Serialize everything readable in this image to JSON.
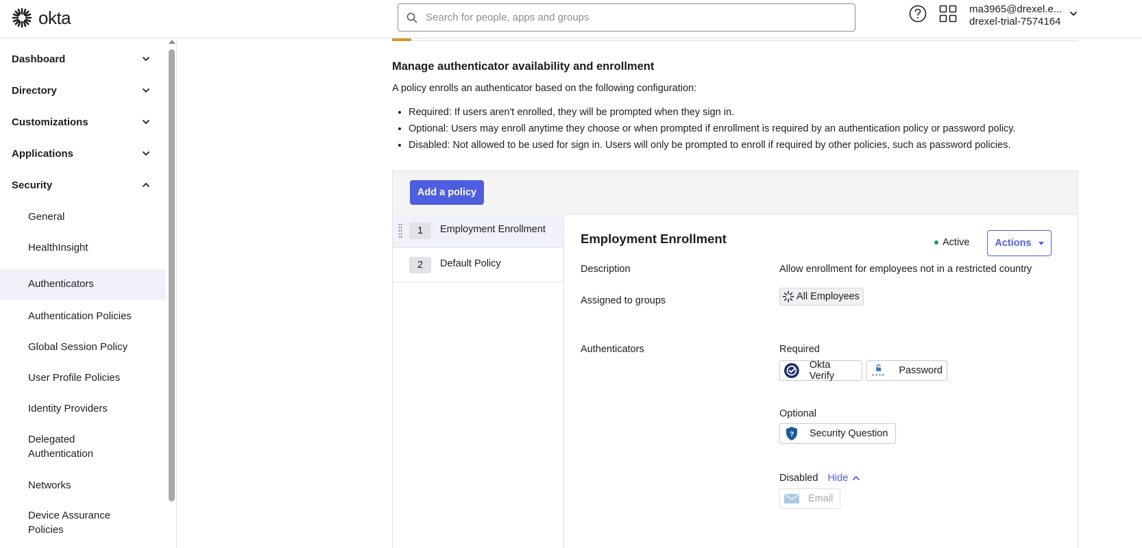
{
  "brand": {
    "name": "okta",
    "accent": "#4d5ee0",
    "active_color": "#1a9b5b"
  },
  "header": {
    "search_placeholder": "Search for people, apps and groups",
    "user_email": "ma3965@drexel.e...",
    "org_name": "drexel-trial-7574164"
  },
  "sidebar": {
    "sections": [
      {
        "label": "Dashboard",
        "expanded": false
      },
      {
        "label": "Directory",
        "expanded": false
      },
      {
        "label": "Customizations",
        "expanded": false
      },
      {
        "label": "Applications",
        "expanded": false
      },
      {
        "label": "Security",
        "expanded": true
      }
    ],
    "security_items": [
      {
        "label": "General"
      },
      {
        "label": "HealthInsight"
      },
      {
        "label": "Authenticators",
        "active": true
      },
      {
        "label": "Authentication Policies"
      },
      {
        "label": "Global Session Policy"
      },
      {
        "label": "User Profile Policies"
      },
      {
        "label": "Identity Providers"
      },
      {
        "label": "Delegated Authentication"
      },
      {
        "label": "Networks"
      },
      {
        "label": "Device Assurance Policies"
      }
    ]
  },
  "main": {
    "section_title": "Manage authenticator availability and enrollment",
    "intro": "A policy enrolls an authenticator based on the following configuration:",
    "rules": [
      "Required: If users aren't enrolled, they will be prompted when they sign in.",
      "Optional: Users may enroll anytime they choose or when prompted if enrollment is required by an authentication policy or password policy.",
      "Disabled: Not allowed to be used for sign in. Users will only be prompted to enroll if required by other policies, such as password policies."
    ],
    "add_policy_label": "Add a policy",
    "policies": [
      {
        "num": "1",
        "name": "Employment Enrollment",
        "selected": true
      },
      {
        "num": "2",
        "name": "Default Policy",
        "selected": false
      }
    ],
    "detail": {
      "title": "Employment Enrollment",
      "status": "Active",
      "actions_label": "Actions",
      "description_label": "Description",
      "description": "Allow enrollment for employees not in a restricted country",
      "groups_label": "Assigned to groups",
      "group": "All Employees",
      "authenticators_label": "Authenticators",
      "required_label": "Required",
      "required": [
        "Okta Verify",
        "Password"
      ],
      "optional_label": "Optional",
      "optional": [
        "Security Question"
      ],
      "disabled_label": "Disabled",
      "hide_label": "Hide",
      "disabled": [
        "Email"
      ]
    }
  }
}
